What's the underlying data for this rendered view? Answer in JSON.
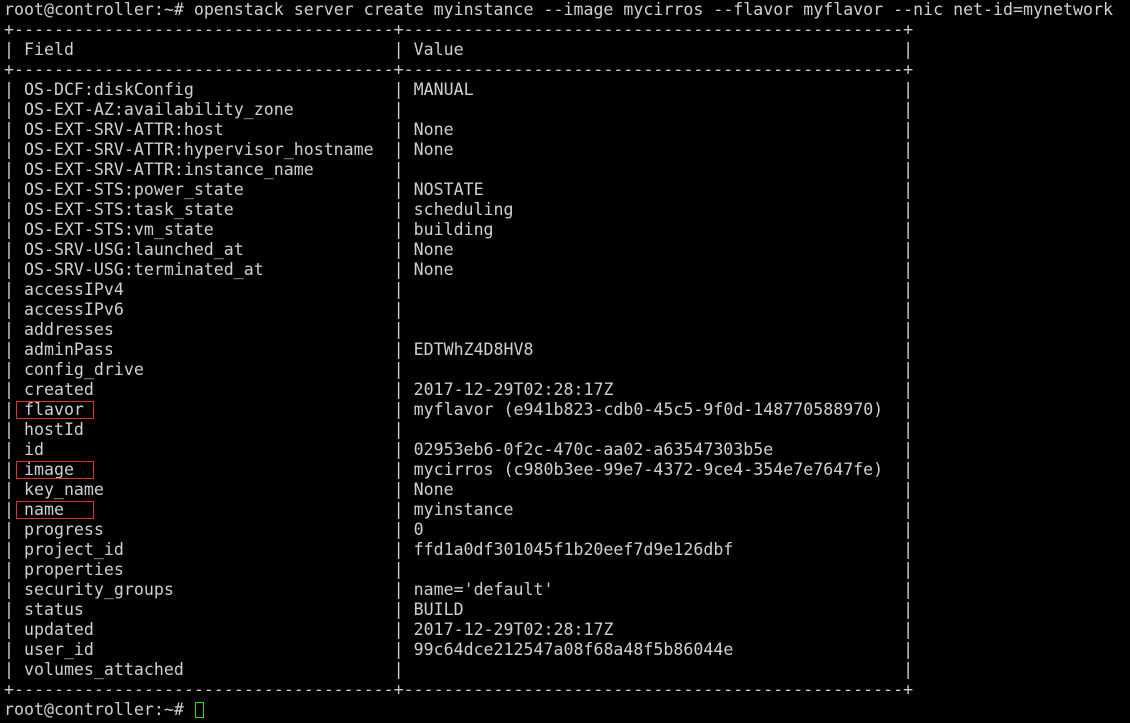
{
  "terminal": {
    "prompt": "root@controller:~#",
    "command": "openstack server create myinstance --image mycirros --flavor myflavor --nic net-id=mynetwork",
    "cursor_color": "#21e021",
    "highlight_color": "#e03030"
  },
  "table": {
    "header": {
      "field": "Field",
      "value": "Value"
    },
    "rows": [
      {
        "field": "OS-DCF:diskConfig",
        "value": "MANUAL"
      },
      {
        "field": "OS-EXT-AZ:availability_zone",
        "value": ""
      },
      {
        "field": "OS-EXT-SRV-ATTR:host",
        "value": "None"
      },
      {
        "field": "OS-EXT-SRV-ATTR:hypervisor_hostname",
        "value": "None"
      },
      {
        "field": "OS-EXT-SRV-ATTR:instance_name",
        "value": ""
      },
      {
        "field": "OS-EXT-STS:power_state",
        "value": "NOSTATE"
      },
      {
        "field": "OS-EXT-STS:task_state",
        "value": "scheduling"
      },
      {
        "field": "OS-EXT-STS:vm_state",
        "value": "building"
      },
      {
        "field": "OS-SRV-USG:launched_at",
        "value": "None"
      },
      {
        "field": "OS-SRV-USG:terminated_at",
        "value": "None"
      },
      {
        "field": "accessIPv4",
        "value": ""
      },
      {
        "field": "accessIPv6",
        "value": ""
      },
      {
        "field": "addresses",
        "value": ""
      },
      {
        "field": "adminPass",
        "value": "EDTWhZ4D8HV8"
      },
      {
        "field": "config_drive",
        "value": ""
      },
      {
        "field": "created",
        "value": "2017-12-29T02:28:17Z"
      },
      {
        "field": "flavor",
        "value": "myflavor (e941b823-cdb0-45c5-9f0d-148770588970)",
        "highlighted": true
      },
      {
        "field": "hostId",
        "value": ""
      },
      {
        "field": "id",
        "value": "02953eb6-0f2c-470c-aa02-a63547303b5e"
      },
      {
        "field": "image",
        "value": "mycirros (c980b3ee-99e7-4372-9ce4-354e7e7647fe)",
        "highlighted": true
      },
      {
        "field": "key_name",
        "value": "None"
      },
      {
        "field": "name",
        "value": "myinstance",
        "highlighted": true
      },
      {
        "field": "progress",
        "value": "0"
      },
      {
        "field": "project_id",
        "value": "ffd1a0df301045f1b20eef7d9e126dbf"
      },
      {
        "field": "properties",
        "value": ""
      },
      {
        "field": "security_groups",
        "value": "name='default'"
      },
      {
        "field": "status",
        "value": "BUILD"
      },
      {
        "field": "updated",
        "value": "2017-12-29T02:28:17Z"
      },
      {
        "field": "user_id",
        "value": "99c64dce212547a08f68a48f5b86044e"
      },
      {
        "field": "volumes_attached",
        "value": ""
      }
    ]
  }
}
